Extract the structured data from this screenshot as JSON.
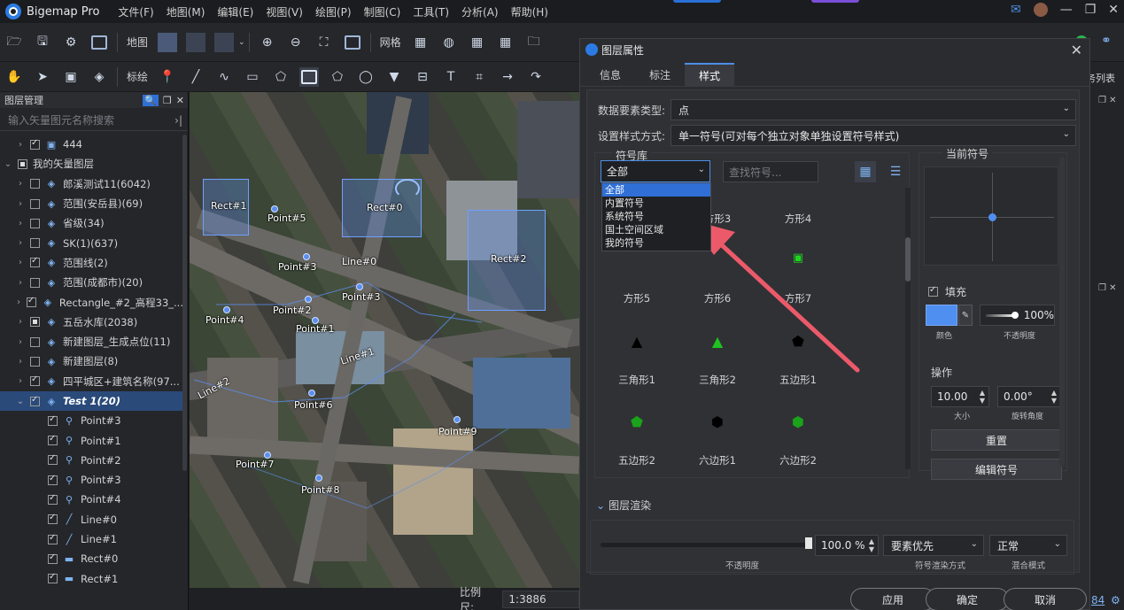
{
  "app": {
    "title": "Bigemap Pro",
    "menu": [
      "文件(F)",
      "地图(M)",
      "编辑(E)",
      "视图(V)",
      "绘图(P)",
      "制图(C)",
      "工具(T)",
      "分析(A)",
      "帮助(H)"
    ],
    "accent_left": "#2a6fd6",
    "accent_right": "#7b4fd8"
  },
  "toolbar": {
    "map_label": "地图",
    "grid_label": "网格",
    "mark_label": "标绘",
    "right_list_label": "务列表"
  },
  "layer_panel": {
    "title": "图层管理",
    "search_placeholder": "输入矢量图元名称搜索",
    "items": [
      {
        "label": "444",
        "indent": 1,
        "check": "on",
        "arrow": "›",
        "icon": "image-icon"
      },
      {
        "label": "我的矢量图层",
        "indent": 0,
        "check": "part",
        "arrow": "⌄",
        "icon": ""
      },
      {
        "label": "郎溪测试11(6042)",
        "indent": 1,
        "check": "off",
        "arrow": "›",
        "icon": "layers-icon"
      },
      {
        "label": "范围(安岳县)(69)",
        "indent": 1,
        "check": "off",
        "arrow": "›",
        "icon": "layers-icon"
      },
      {
        "label": "省级(34)",
        "indent": 1,
        "check": "off",
        "arrow": "›",
        "icon": "layers-icon"
      },
      {
        "label": "SK(1)(637)",
        "indent": 1,
        "check": "off",
        "arrow": "›",
        "icon": "layers-icon"
      },
      {
        "label": "范围线(2)",
        "indent": 1,
        "check": "on",
        "arrow": "›",
        "icon": "layers-icon"
      },
      {
        "label": "范围(成都市)(20)",
        "indent": 1,
        "check": "off",
        "arrow": "›",
        "icon": "layers-icon"
      },
      {
        "label": "Rectangle_#2_高程33_...",
        "indent": 1,
        "check": "on",
        "arrow": "›",
        "icon": "layers-icon"
      },
      {
        "label": "五岳水库(2038)",
        "indent": 1,
        "check": "part",
        "arrow": "›",
        "icon": "layers-icon"
      },
      {
        "label": "新建图层_生成点位(11)",
        "indent": 1,
        "check": "off",
        "arrow": "›",
        "icon": "layers-icon"
      },
      {
        "label": "新建图层(8)",
        "indent": 1,
        "check": "off",
        "arrow": "›",
        "icon": "layers-icon"
      },
      {
        "label": "四平城区+建筑名称(97...",
        "indent": 1,
        "check": "on",
        "arrow": "›",
        "icon": "layers-icon"
      },
      {
        "label": "Test 1(20)",
        "indent": 1,
        "check": "on",
        "arrow": "⌄",
        "icon": "layers-icon",
        "selected": true
      },
      {
        "label": "Point#3",
        "indent": 2,
        "check": "on",
        "arrow": "",
        "icon": "pin-icon"
      },
      {
        "label": "Point#1",
        "indent": 2,
        "check": "on",
        "arrow": "",
        "icon": "pin-icon"
      },
      {
        "label": "Point#2",
        "indent": 2,
        "check": "on",
        "arrow": "",
        "icon": "pin-icon"
      },
      {
        "label": "Point#3",
        "indent": 2,
        "check": "on",
        "arrow": "",
        "icon": "pin-icon"
      },
      {
        "label": "Point#4",
        "indent": 2,
        "check": "on",
        "arrow": "",
        "icon": "pin-icon"
      },
      {
        "label": "Line#0",
        "indent": 2,
        "check": "on",
        "arrow": "",
        "icon": "line-icon"
      },
      {
        "label": "Line#1",
        "indent": 2,
        "check": "on",
        "arrow": "",
        "icon": "line-icon"
      },
      {
        "label": "Rect#0",
        "indent": 2,
        "check": "on",
        "arrow": "",
        "icon": "rect-icon"
      },
      {
        "label": "Rect#1",
        "indent": 2,
        "check": "on",
        "arrow": "",
        "icon": "rect-icon"
      }
    ]
  },
  "map": {
    "labels": [
      "Rect#1",
      "Point#5",
      "Rect#0",
      "Rect#2",
      "Point#3",
      "Line#0",
      "Point#3",
      "Point#2",
      "Point#4",
      "Point#1",
      "Line#1",
      "Line#2",
      "Point#6",
      "Point#9",
      "Point#7",
      "Point#8"
    ]
  },
  "status": {
    "scale_label": "比例尺:",
    "scale_value": "1:3886"
  },
  "dialog": {
    "title": "图层属性",
    "tabs": [
      "信息",
      "标注",
      "样式"
    ],
    "active_tab": "样式",
    "feature_type_label": "数据要素类型:",
    "feature_type_value": "点",
    "style_mode_label": "设置样式方式:",
    "style_mode_value": "单一符号(可对每个独立对象单独设置符号样式)",
    "symbol_library": {
      "title": "符号库",
      "category_value": "全部",
      "search_placeholder": "查找符号...",
      "dropdown_options": [
        "全部",
        "内置符号",
        "系统符号",
        "国土空间区域",
        "我的符号"
      ],
      "symbols": [
        {
          "name": "方形3",
          "glyph": "",
          "color": "#000000"
        },
        {
          "name": "方形4",
          "glyph": "",
          "color": "#000000"
        },
        {
          "name": "方形5",
          "glyph": "",
          "color": "#000000"
        },
        {
          "name": "方形6",
          "glyph": "",
          "color": "#1aa31a"
        },
        {
          "name": "方形7",
          "glyph": "▣",
          "color": "#1fd61f"
        },
        {
          "name": "三角形1",
          "glyph": "▲",
          "color": "#000000"
        },
        {
          "name": "三角形2",
          "glyph": "▲",
          "color": "#1fc21f"
        },
        {
          "name": "五边形1",
          "glyph": "⬟",
          "color": "#000000"
        },
        {
          "name": "五边形2",
          "glyph": "⬟",
          "color": "#1aa31a"
        },
        {
          "name": "六边形1",
          "glyph": "⬢",
          "color": "#000000"
        },
        {
          "name": "六边形2",
          "glyph": "⬢",
          "color": "#1aa31a"
        }
      ]
    },
    "current_symbol": {
      "title": "当前符号",
      "fill_label": "填充",
      "fill_color": "#4f8ff0",
      "color_label": "颜色",
      "opacity_value": "100%",
      "opacity_label": "不透明度",
      "ops_label": "操作",
      "size_value": "10.00",
      "size_label": "大小",
      "rotation_value": "0.00°",
      "rotation_label": "旋转角度",
      "reset_button": "重置",
      "edit_button": "编辑符号"
    },
    "render": {
      "title": "图层渲染",
      "opacity_value": "100.0 %",
      "opacity_label": "不透明度",
      "render_mode_value": "要素优先",
      "render_mode_label": "符号渲染方式",
      "blend_value": "正常",
      "blend_label": "混合模式"
    },
    "buttons": {
      "apply": "应用",
      "ok": "确定",
      "cancel": "取消"
    }
  },
  "right_strip": {
    "tail_text": "84"
  }
}
